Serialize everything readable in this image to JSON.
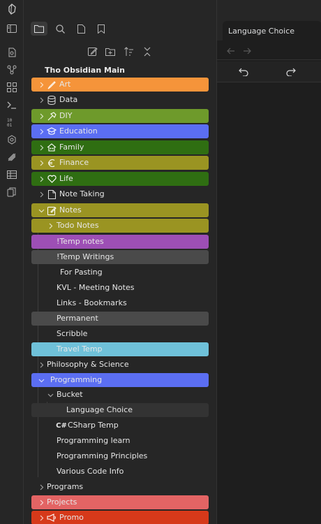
{
  "sidebar": {
    "vault_title": "Tho Obsidian Main",
    "tree": [
      {
        "label": "Art",
        "icon": "brush-icon",
        "bg": "#f5943a",
        "chev": "right"
      },
      {
        "label": "Data",
        "icon": "database-icon",
        "bg": "",
        "chev": "right"
      },
      {
        "label": "DIY",
        "icon": "hammer-icon",
        "bg": "#6e9a2b",
        "chev": "right"
      },
      {
        "label": "Education",
        "icon": "graduation-cap-icon",
        "bg": "#5b6ef2",
        "chev": "right"
      },
      {
        "label": "Family",
        "icon": "family-icon",
        "bg": "#2f6e12",
        "chev": "right"
      },
      {
        "label": "Finance",
        "icon": "euro-icon",
        "bg": "#9a9422",
        "chev": "right"
      },
      {
        "label": "Life",
        "icon": "heart-icon",
        "bg": "#2f6e12",
        "chev": "right"
      },
      {
        "label": "Note Taking",
        "icon": "file-icon",
        "bg": "",
        "chev": "right"
      },
      {
        "label": "Notes",
        "icon": "edit-icon",
        "bg": "#9a9422",
        "chev": "down"
      },
      {
        "label": "Todo Notes",
        "icon": "",
        "bg": "#9a9422",
        "chev": "right"
      },
      {
        "label": "!Temp notes",
        "icon": "",
        "bg": "#9d4fb5",
        "chev": ""
      },
      {
        "label": "!Temp Writings",
        "icon": "",
        "bg": "#4a4a4a",
        "chev": ""
      },
      {
        "label": "For Pasting",
        "icon": "",
        "bg": "",
        "chev": ""
      },
      {
        "label": "KVL - Meeting Notes",
        "icon": "",
        "bg": "",
        "chev": ""
      },
      {
        "label": "Links - Bookmarks",
        "icon": "",
        "bg": "",
        "chev": ""
      },
      {
        "label": "Permanent",
        "icon": "",
        "bg": "#4a4a4a",
        "chev": ""
      },
      {
        "label": "Scribble",
        "icon": "",
        "bg": "",
        "chev": ""
      },
      {
        "label": "Travel Temp",
        "icon": "",
        "bg": "#6fc1d9",
        "chev": ""
      },
      {
        "label": "Philosophy & Science",
        "icon": "",
        "bg": "",
        "chev": "right"
      },
      {
        "label": "Programming",
        "icon": "",
        "bg": "#5b6ef2",
        "chev": "down"
      },
      {
        "label": "Bucket",
        "icon": "",
        "bg": "",
        "chev": "down"
      },
      {
        "label": "Language Choice",
        "icon": "",
        "bg": "#333333",
        "chev": ""
      },
      {
        "label": "CSharp Temp",
        "icon": "csharp-icon",
        "icon_text": "C#",
        "bg": "",
        "chev": ""
      },
      {
        "label": "Programming learn",
        "icon": "",
        "bg": "",
        "chev": ""
      },
      {
        "label": "Programming Principles",
        "icon": "",
        "bg": "",
        "chev": ""
      },
      {
        "label": "Various Code Info",
        "icon": "",
        "bg": "",
        "chev": ""
      },
      {
        "label": "Programs",
        "icon": "",
        "bg": "",
        "chev": "right"
      },
      {
        "label": "Projects",
        "icon": "",
        "bg": "#e36464",
        "chev": "right"
      },
      {
        "label": "Promo",
        "icon": "megaphone-icon",
        "bg": "#d6391a",
        "chev": "right"
      }
    ]
  },
  "main": {
    "tab_title": "Language Choice"
  }
}
